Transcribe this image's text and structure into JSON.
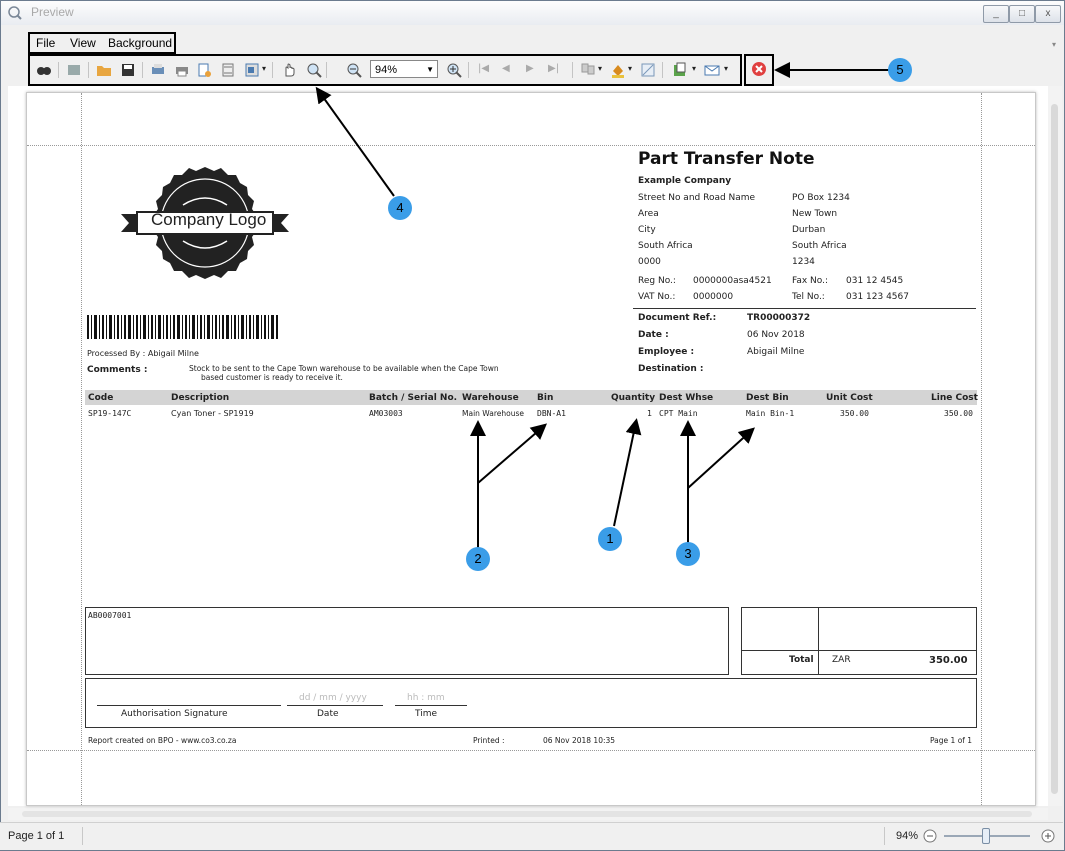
{
  "window": {
    "title": "Preview",
    "min_label": "_",
    "max_label": "□",
    "close_label": "x"
  },
  "menu": [
    {
      "label": "File"
    },
    {
      "label": "View"
    },
    {
      "label": "Background"
    }
  ],
  "toolbar": {
    "zoom_value": "94%"
  },
  "report": {
    "logo_text": "Company Logo",
    "title": "Part Transfer Note",
    "company": {
      "name": "Example Company",
      "address_left": [
        "Street No and Road Name",
        "Area",
        "City",
        "South Africa",
        "0000"
      ],
      "address_right": [
        "PO Box 1234",
        "New Town",
        "Durban",
        "South Africa",
        "1234"
      ],
      "reg_label": "Reg No.:",
      "reg_value": "0000000asa4521",
      "fax_label": "Fax No.:",
      "fax_value": "031 12 4545",
      "vat_label": "VAT No.:",
      "vat_value": "0000000",
      "tel_label": "Tel No.:",
      "tel_value": "031 123 4567"
    },
    "processed_by": "Processed By : Abigail Milne",
    "comments_label": "Comments :",
    "comments_text_1": "Stock to be sent to the Cape Town warehouse to be available when the Cape Town",
    "comments_text_2": "based customer is ready to receive it.",
    "doc_ref_label": "Document Ref.:",
    "doc_ref_value": "TR00000372",
    "date_label": "Date :",
    "date_value": "06 Nov 2018",
    "employee_label": "Employee :",
    "employee_value": "Abigail Milne",
    "destination_label": "Destination :",
    "columns": [
      "Code",
      "Description",
      "Batch / Serial No.",
      "Warehouse",
      "Bin",
      "Quantity",
      "Dest Whse",
      "Dest Bin",
      "Unit Cost",
      "Line Cost"
    ],
    "row": {
      "code": "SP19-147C",
      "description": "Cyan Toner - SP1919",
      "batch": "AM03003",
      "warehouse": "Main Warehouse",
      "bin": "DBN-A1",
      "quantity": "1",
      "dest_whse": "CPT Main",
      "dest_bin": "Main Bin-1",
      "unit_cost": "350.00",
      "line_cost": "350.00"
    },
    "barcode_text": "AB0007001",
    "total_label": "Total",
    "currency": "ZAR",
    "total_value": "350.00",
    "sig_label": "Authorisation Signature",
    "date_ph": "dd / mm / yyyy",
    "date_cap": "Date",
    "time_ph": "hh : mm",
    "time_cap": "Time",
    "footer_left": "Report created on BPO - www.co3.co.za",
    "printed_label": "Printed :",
    "printed_value": "06 Nov 2018 10:35",
    "page_label": "Page 1 of 1"
  },
  "callouts": [
    "1",
    "2",
    "3",
    "4",
    "5"
  ],
  "status": {
    "page": "Page 1 of 1",
    "zoom": "94%"
  }
}
